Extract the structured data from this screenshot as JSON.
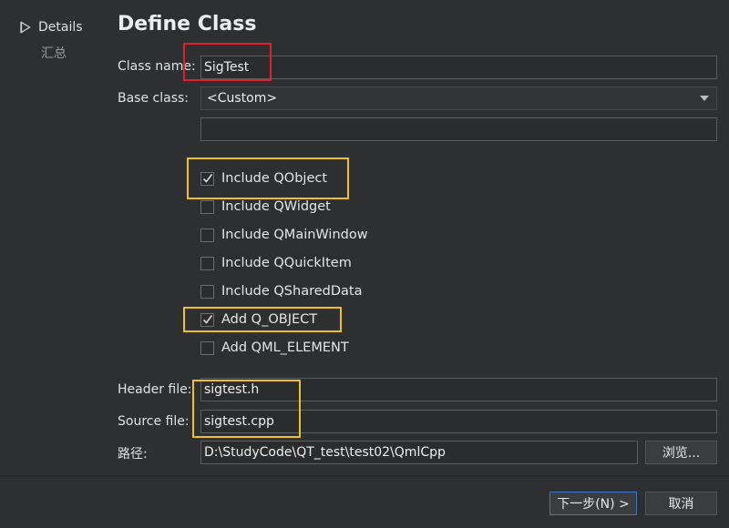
{
  "sidebar": {
    "step_label": "Details",
    "sub_label": "汇总"
  },
  "page": {
    "title": "Define Class"
  },
  "form": {
    "class_name_label": "Class name:",
    "class_name_value": "SigTest",
    "base_class_label": "Base class:",
    "base_class_value": "<Custom>",
    "custom_base_value": "",
    "header_file_label": "Header file:",
    "header_file_value": "sigtest.h",
    "source_file_label": "Source file:",
    "source_file_value": "sigtest.cpp",
    "path_label": "路径:",
    "path_value": "D:\\StudyCode\\QT_test\\test02\\QmlCpp",
    "browse_label": "浏览..."
  },
  "options": [
    {
      "label": "Include QObject",
      "checked": true
    },
    {
      "label": "Include QWidget",
      "checked": false
    },
    {
      "label": "Include QMainWindow",
      "checked": false
    },
    {
      "label": "Include QQuickItem",
      "checked": false
    },
    {
      "label": "Include QSharedData",
      "checked": false
    },
    {
      "label": "Add Q_OBJECT",
      "checked": true
    },
    {
      "label": "Add QML_ELEMENT",
      "checked": false
    }
  ],
  "footer": {
    "next_label": "下一步(N) >",
    "cancel_label": "取消"
  },
  "colors": {
    "background": "#2e2f30",
    "annotation_red": "#e0202a",
    "annotation_yellow": "#f0c020",
    "primary_border": "#3a78c8"
  }
}
